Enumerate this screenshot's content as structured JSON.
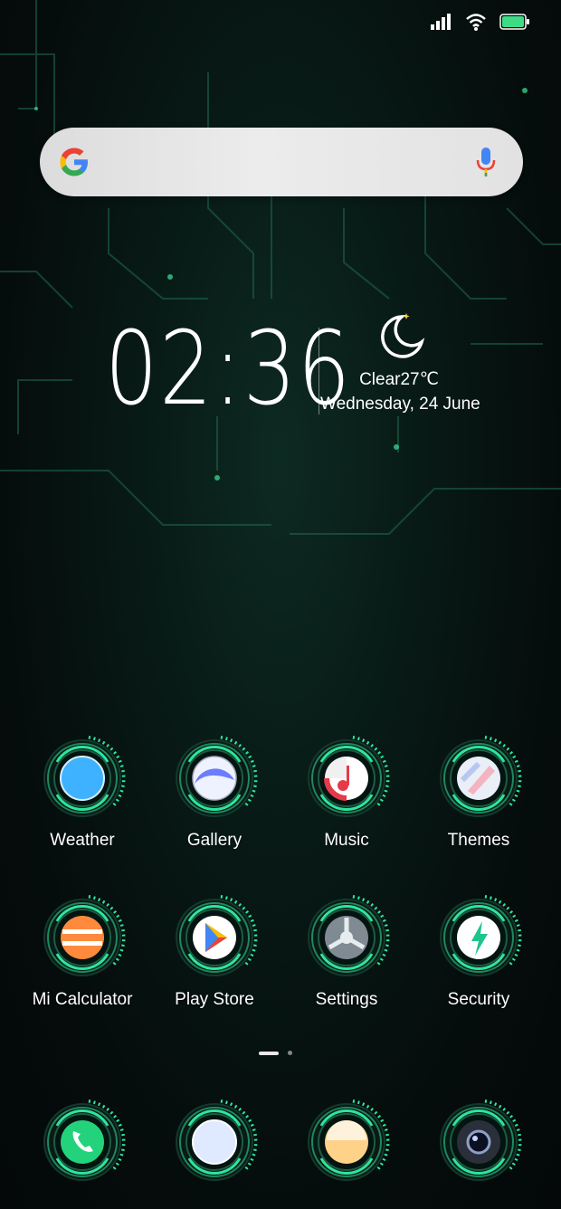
{
  "status_bar": {
    "icons": [
      "signal-icon",
      "wifi-icon",
      "battery-icon"
    ],
    "battery_color": "#3ddc84"
  },
  "search": {
    "logo": "google-logo",
    "mic": "mic-icon"
  },
  "clock": {
    "time": "02:36"
  },
  "weather": {
    "icon": "moon-icon",
    "condition": "Clear27℃",
    "date": "Wednesday, 24 June"
  },
  "apps": [
    {
      "label": "Weather",
      "icon": "weather-icon"
    },
    {
      "label": "Gallery",
      "icon": "gallery-icon"
    },
    {
      "label": "Music",
      "icon": "music-icon"
    },
    {
      "label": "Themes",
      "icon": "themes-icon"
    },
    {
      "label": "Mi Calculator",
      "icon": "calculator-icon"
    },
    {
      "label": "Play Store",
      "icon": "play-store-icon"
    },
    {
      "label": "Settings",
      "icon": "settings-icon"
    },
    {
      "label": "Security",
      "icon": "security-icon"
    }
  ],
  "dock": [
    {
      "icon": "phone-icon"
    },
    {
      "icon": "messages-icon"
    },
    {
      "icon": "browser-icon"
    },
    {
      "icon": "camera-icon"
    }
  ],
  "page_indicator": {
    "pages": 2,
    "current": 1
  },
  "colors": {
    "accent_green": "#2ee59d",
    "background": "#06120f"
  }
}
